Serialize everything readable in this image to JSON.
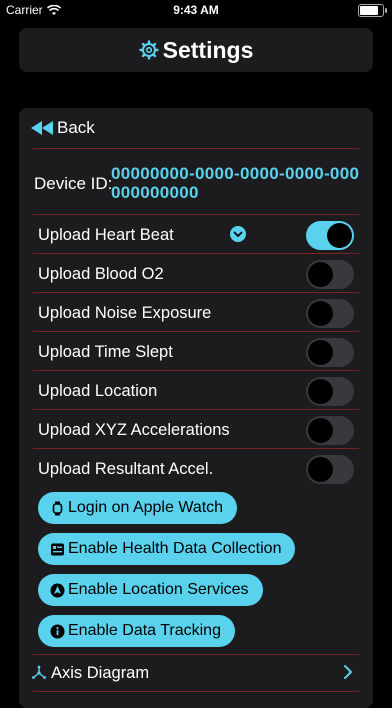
{
  "status_bar": {
    "carrier": "Carrier",
    "time": "9:43 AM",
    "battery_level": 0.9
  },
  "header": {
    "title": "Settings",
    "icon": "gear-icon"
  },
  "back": {
    "label": "Back",
    "icon": "rewind-icon"
  },
  "device": {
    "label": "Device ID:",
    "value": "00000000-0000-0000-0000-000000000000"
  },
  "toggles": [
    {
      "label": "Upload Heart Beat",
      "on": true
    },
    {
      "label": "Upload Blood O2",
      "on": false
    },
    {
      "label": "Upload Noise Exposure",
      "on": false
    },
    {
      "label": "Upload Time Slept",
      "on": false
    },
    {
      "label": "Upload Location",
      "on": false
    },
    {
      "label": "Upload XYZ Accelerations",
      "on": false
    },
    {
      "label": "Upload Resultant Accel.",
      "on": false
    }
  ],
  "buttons": [
    {
      "label": "Login on Apple Watch",
      "icon": "applewatch-icon"
    },
    {
      "label": "Enable Health Data Collection",
      "icon": "health-record-icon"
    },
    {
      "label": "Enable Location Services",
      "icon": "location-arrow-icon"
    },
    {
      "label": "Enable Data Tracking",
      "icon": "info-icon"
    }
  ],
  "axis_diagram": {
    "label": "Axis Diagram",
    "icon": "axis-icon"
  },
  "colors": {
    "accent": "#5ad2ee",
    "divider": "#7a2222",
    "card": "#1c1c1e",
    "background": "#000000"
  }
}
